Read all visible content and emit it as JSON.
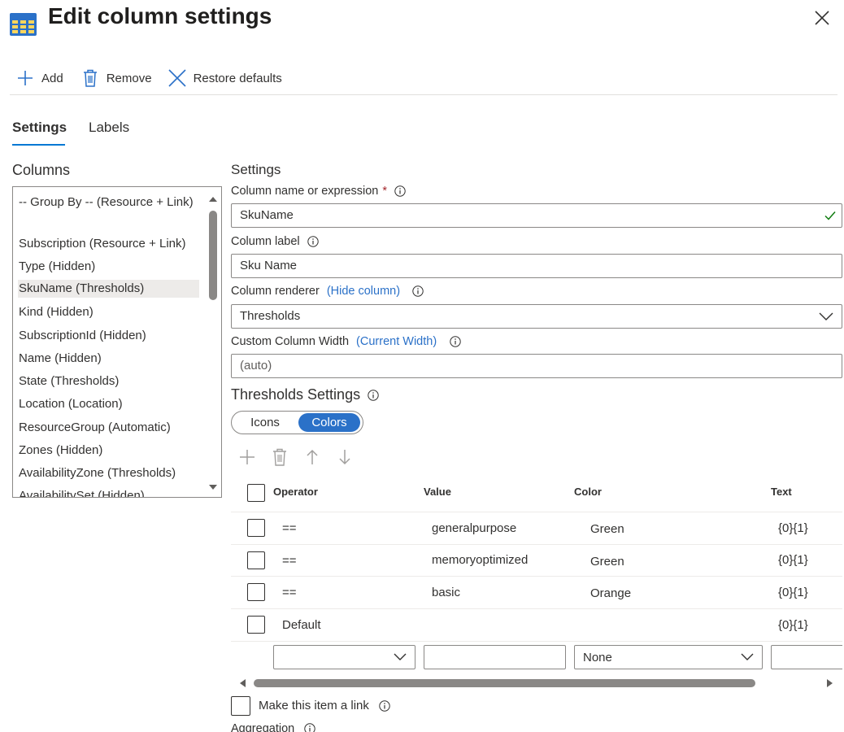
{
  "header": {
    "title": "Edit column settings"
  },
  "toolbar": {
    "add_label": "Add",
    "remove_label": "Remove",
    "restore_label": "Restore defaults"
  },
  "tabs": [
    {
      "label": "Settings",
      "active": true
    },
    {
      "label": "Labels",
      "active": false
    }
  ],
  "columns": {
    "title": "Columns",
    "items": [
      {
        "label": "-- Group By -- (Resource + Link)"
      },
      {
        "label": "Subscription (Resource + Link)"
      },
      {
        "label": "Type (Hidden)"
      },
      {
        "label": "SkuName (Thresholds)",
        "selected": true
      },
      {
        "label": "Kind (Hidden)"
      },
      {
        "label": "SubscriptionId (Hidden)"
      },
      {
        "label": "Name (Hidden)"
      },
      {
        "label": "State (Thresholds)"
      },
      {
        "label": "Location (Location)"
      },
      {
        "label": "ResourceGroup (Automatic)"
      },
      {
        "label": "Zones (Hidden)"
      },
      {
        "label": "AvailabilityZone (Thresholds)"
      },
      {
        "label": "AvailabilitySet (Hidden)"
      }
    ]
  },
  "settings": {
    "title": "Settings",
    "column_name": {
      "label": "Column name or expression",
      "required_mark": "*",
      "value": "SkuName"
    },
    "column_label": {
      "label": "Column label",
      "value": "Sku Name"
    },
    "column_renderer": {
      "label": "Column renderer",
      "link": "(Hide column)",
      "value": "Thresholds"
    },
    "custom_width": {
      "label": "Custom Column Width",
      "link": "(Current Width)",
      "placeholder": "(auto)"
    }
  },
  "thresholds": {
    "title": "Thresholds Settings",
    "toggle": {
      "option_off": "Icons",
      "option_on": "Colors",
      "selected": "Colors"
    },
    "headers": {
      "operator": "Operator",
      "value": "Value",
      "color": "Color",
      "text": "Text"
    },
    "rows": [
      {
        "operator": "==",
        "value": "generalpurpose",
        "color": "Green",
        "text": "{0}{1}"
      },
      {
        "operator": "==",
        "value": "memoryoptimized",
        "color": "Green",
        "text": "{0}{1}"
      },
      {
        "operator": "==",
        "value": "basic",
        "color": "Orange",
        "text": "{0}{1}"
      },
      {
        "operator": "Default",
        "value": "",
        "color": "",
        "text": "{0}{1}"
      }
    ],
    "new_row": {
      "operator": "",
      "value": "",
      "color": "None",
      "text": ""
    }
  },
  "footer": {
    "make_link_label": "Make this item a link",
    "aggregation_label": "Aggregation"
  },
  "colors": {
    "accent": "#0078d4",
    "toggle_on": "#2b71c8",
    "link": "#2b71c8",
    "success": "#107c10",
    "required": "#a4262c"
  }
}
